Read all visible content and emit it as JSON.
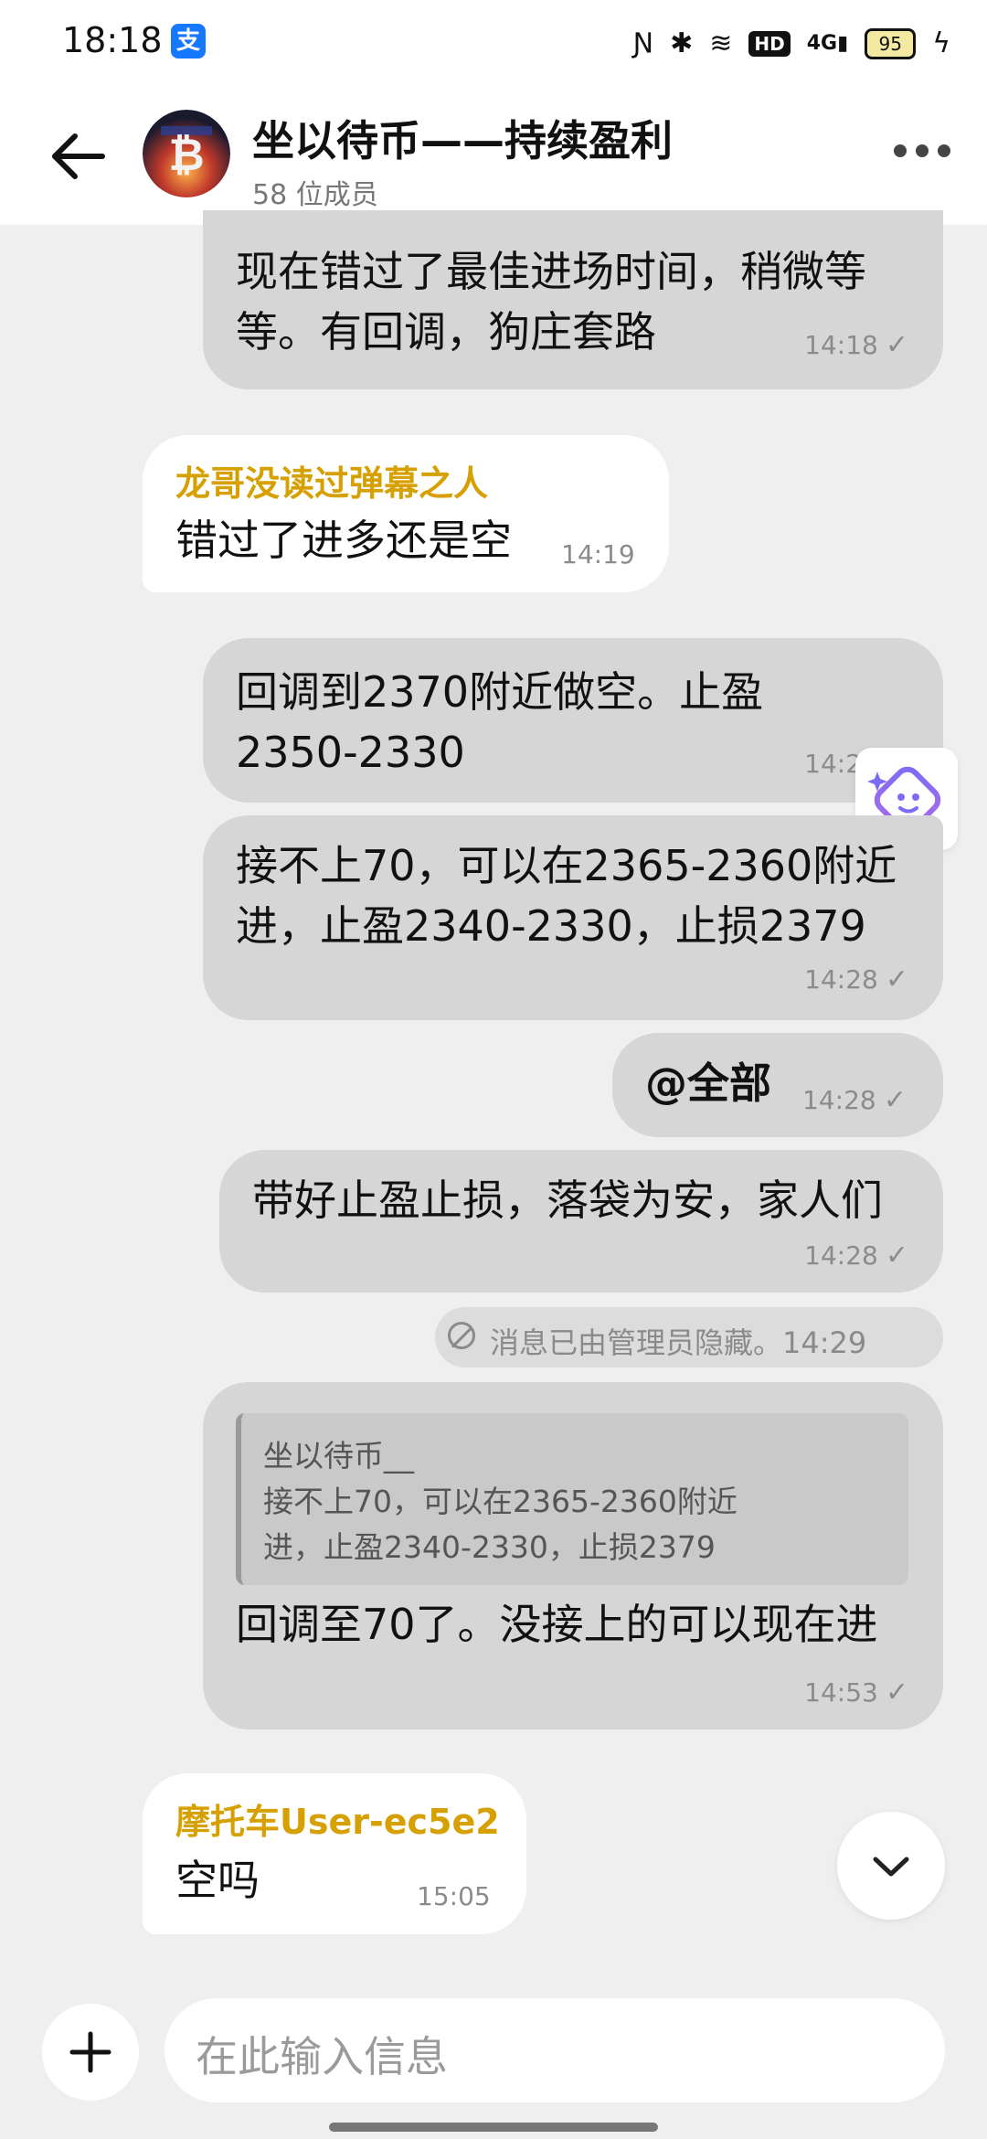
{
  "status_bar": {
    "time": "18:18",
    "app_icon": "支",
    "hd": "HD",
    "network": "4G",
    "battery": "95"
  },
  "header": {
    "title": "坐以待币——持续盈利",
    "members": "58 位成员"
  },
  "messages": [
    {
      "type": "out",
      "lines": [
        "现在错过了最佳进场时间，稍微等",
        "等。有回调，狗庄套路"
      ],
      "time": "14:18"
    },
    {
      "type": "in",
      "sender": "龙哥没读过弹幕之人",
      "lines": [
        "错过了进多还是空"
      ],
      "time": "14:19"
    },
    {
      "type": "out",
      "lines": [
        "回调到2370附近做空。止盈",
        "2350-2330"
      ],
      "time": "14:28"
    },
    {
      "type": "out",
      "lines": [
        "接不上70，可以在2365-2360附近",
        "进，止盈2340-2330，止损2379"
      ],
      "time": "14:28"
    },
    {
      "type": "out",
      "lines": [
        "@全部"
      ],
      "time": "14:28"
    },
    {
      "type": "out",
      "lines": [
        "带好止盈止损，落袋为安，家人们"
      ],
      "time": "14:28"
    },
    {
      "type": "system",
      "text": "消息已由管理员隐藏。14:29"
    },
    {
      "type": "out",
      "quote": {
        "sender": "坐以待币__",
        "lines": [
          "接不上70，可以在2365-2360附近",
          "进，止盈2340-2330，止损2379"
        ]
      },
      "lines": [
        "回调至70了。没接上的可以现在进"
      ],
      "time": "14:53"
    },
    {
      "type": "in",
      "sender": "摩托车User-ec5e2",
      "lines": [
        "空吗"
      ],
      "time": "15:05"
    }
  ],
  "composer": {
    "placeholder": "在此输入信息"
  },
  "colors": {
    "sender_name": "#d6a000",
    "outgoing_bubble": "#d6d6d6",
    "incoming_bubble": "#ffffff",
    "background": "#efefef"
  },
  "icons": [
    "back-arrow-icon",
    "more-icon",
    "add-icon",
    "chevron-down-icon",
    "ai-assistant-icon",
    "read-check-icon"
  ]
}
